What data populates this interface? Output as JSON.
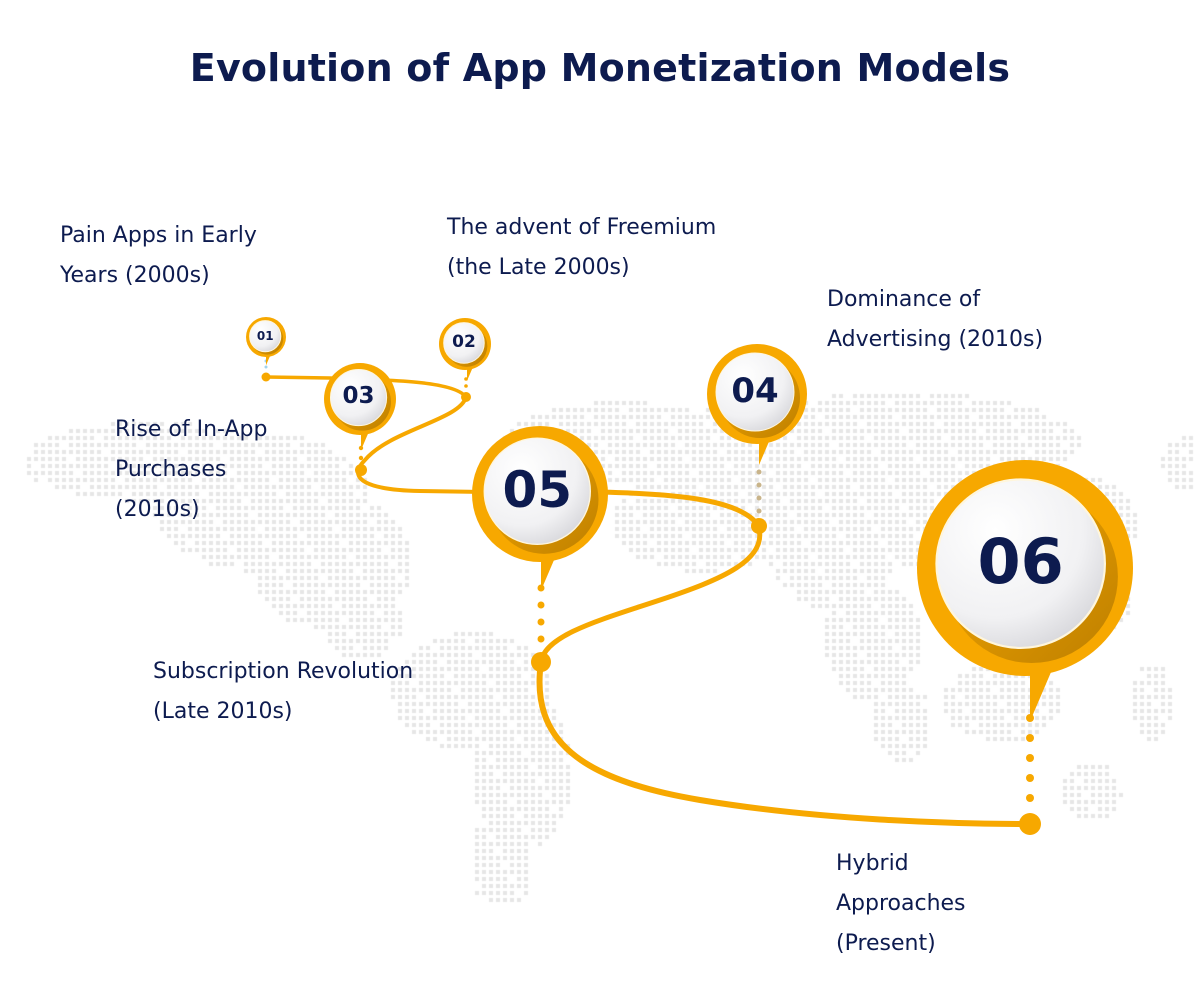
{
  "title": "Evolution of App Monetization Models",
  "colors": {
    "accent": "#f7a800",
    "text": "#0d1b4f",
    "pin_face": "#f1f1f3",
    "map_dot": "#e6e6e6"
  },
  "steps": [
    {
      "number": "01",
      "label": "Pain Apps in Early\nYears (2000s)"
    },
    {
      "number": "02",
      "label": "The advent of Freemium\n(the Late 2000s)"
    },
    {
      "number": "03",
      "label": "Rise of In-App\nPurchases\n(2010s)"
    },
    {
      "number": "04",
      "label": "Dominance of\nAdvertising (2010s)"
    },
    {
      "number": "05",
      "label": "Subscription Revolution\n(Late 2010s)"
    },
    {
      "number": "06",
      "label": "Hybrid\nApproaches\n(Present)"
    }
  ],
  "background": {
    "icon": "world-map-dots"
  }
}
